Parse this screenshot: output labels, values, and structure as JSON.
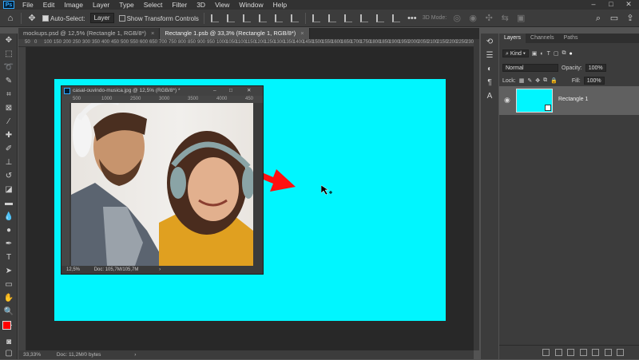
{
  "app": {
    "logo": "Ps"
  },
  "menu": [
    "File",
    "Edit",
    "Image",
    "Layer",
    "Type",
    "Select",
    "Filter",
    "3D",
    "View",
    "Window",
    "Help"
  ],
  "window_controls": {
    "minimize": "–",
    "maximize": "□",
    "close": "✕"
  },
  "options": {
    "auto_select_label": "Auto-Select:",
    "auto_select_target": "Layer",
    "show_transform_label": "Show Transform Controls",
    "mode_3d": "3D Mode:"
  },
  "tabs": [
    {
      "label": "mockups.psd @ 12,5% (Rectangle 1, RGB/8*)",
      "close": "×"
    },
    {
      "label": "Rectangle 1.psb @ 33,3% (Rectangle 1, RGB/8*)",
      "close": "×"
    }
  ],
  "ruler_top": [
    "50",
    "0",
    "100",
    "150",
    "200",
    "250",
    "300",
    "350",
    "400",
    "450",
    "500",
    "550",
    "600",
    "650",
    "700",
    "750",
    "800",
    "850",
    "900",
    "950",
    "1000",
    "1050",
    "1100",
    "1150",
    "1200",
    "1250",
    "1300",
    "1350",
    "1400",
    "1450",
    "1500",
    "1550",
    "1600",
    "1650",
    "1700",
    "1750",
    "1800",
    "1850",
    "1900",
    "1950",
    "2000",
    "2050",
    "2100",
    "2150",
    "2200",
    "2250",
    "2300"
  ],
  "inner_window": {
    "title": "casal-ouvindo-musica.jpg @ 12,5% (RGB/8*) *",
    "ruler": [
      "500",
      "1000",
      "2500",
      "3000",
      "3500",
      "4000",
      "450"
    ],
    "zoom": "12,5%",
    "doc": "Doc: 105,7M/105,7M"
  },
  "status": {
    "zoom": "33,33%",
    "doc": "Doc: 11,2M/0 bytes"
  },
  "panels": {
    "tabs": [
      "Layers",
      "Channels",
      "Paths"
    ],
    "kind": "Kind",
    "blend_mode": "Normal",
    "opacity_label": "Opacity:",
    "opacity_value": "100%",
    "lock_label": "Lock:",
    "fill_label": "Fill:",
    "fill_value": "100%",
    "layer_name": "Rectangle 1"
  },
  "colors": {
    "canvas": "#00f6ff",
    "foreground": "#ff0000",
    "background": "#ffffff",
    "arrow": "#ff1010"
  }
}
